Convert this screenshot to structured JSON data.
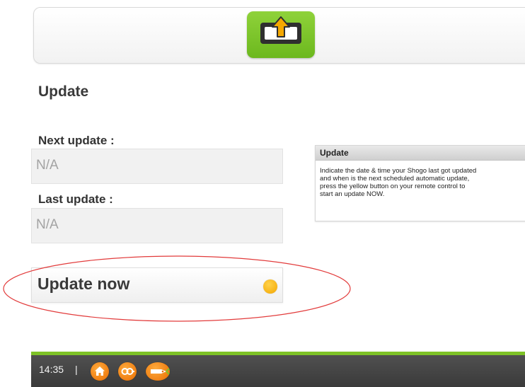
{
  "screen": {
    "title": "Update"
  },
  "fields": {
    "next_label": "Next update :",
    "next_value": "N/A",
    "last_label": "Last update :",
    "last_value": "N/A"
  },
  "action": {
    "update_now_label": "Update now",
    "button_color": "#f7b500"
  },
  "help": {
    "title": "Update",
    "text": "Indicate the date & time your Shogo last got updated\nand when is the next scheduled automatic update,\npress the yellow button on your remote control to\nstart an update NOW."
  },
  "status_bar": {
    "time": "14:35",
    "separator": "|",
    "icons": [
      "home-icon",
      "keys-icon",
      "tag-icon"
    ],
    "accent": "#7ec227"
  },
  "colors": {
    "brand_green": "#7ec227",
    "highlight_ellipse": "#e23b3b",
    "orange": "#f08a00"
  }
}
